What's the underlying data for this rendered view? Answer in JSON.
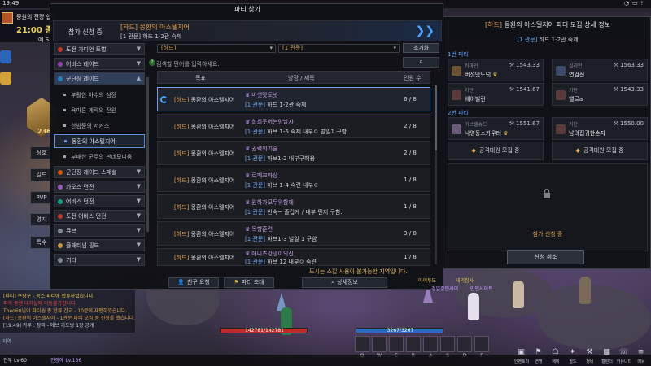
{
  "hud": {
    "clock": "19:49",
    "quest_title": "중원의 전장 합류",
    "quest_time": "21:00 종료",
    "quest_sub": "예 S",
    "side_menu": [
      "징호",
      "길드",
      "PVP",
      "명지",
      "특수"
    ],
    "emblem_number": "236",
    "top_icons": [
      "wifi-icon",
      "battery-icon",
      "signal-icon"
    ]
  },
  "window": {
    "title": "파티 찾기",
    "banner_label": "참가 신청 중",
    "banner_title": "[하드] 몽환의 아스텔지어",
    "banner_sub": "[1 관문] 하드 1-2관 숙제"
  },
  "categories": [
    {
      "label": "도전 가디언 토벌",
      "dot": "#c0392b",
      "expanded": false
    },
    {
      "label": "어비스 레이드",
      "dot": "#8e44ad",
      "expanded": false
    },
    {
      "label": "군단장 레이드",
      "dot": "#2980b9",
      "expanded": true
    }
  ],
  "sub_items": [
    "부활한 아수의 심장",
    "욕마른 계략의 잔원",
    "한밤중의 서커스",
    "몽환의 아스텔지어",
    "부패한 군주의 판데모니움"
  ],
  "categories_below": [
    {
      "label": "군단장 레이드 스페셜",
      "dot": "#d35400"
    },
    {
      "label": "카오스 던전",
      "dot": "#9b59b6"
    },
    {
      "label": "어비스 던전",
      "dot": "#16a085"
    },
    {
      "label": "도전 어비스 던전",
      "dot": "#c0392b"
    },
    {
      "label": "큐브",
      "dot": "#7f8c8d"
    },
    {
      "label": "플래티넘 필드",
      "dot": "#c39b3a"
    },
    {
      "label": "기타",
      "dot": "#7f8c8d"
    }
  ],
  "filters": {
    "difficulty": "[하드]",
    "stage": "[1 관문]",
    "reset": "초기화",
    "hint": "검색할 단어를 입력하세요.",
    "search_icon": "magnifier-icon"
  },
  "table": {
    "headers": [
      "목표",
      "방장 / 제목",
      "인원 수"
    ],
    "rows": [
      {
        "tag": "[하드]",
        "dungeon": "몽환의 아스텔지어",
        "leader": "버섯맛도넛",
        "stage": "[1 관문]",
        "desc": "하드 1-2관 숙제",
        "count": "6 / 8",
        "selected": true
      },
      {
        "tag": "[하드]",
        "dungeon": "몽환의 아스텔지어",
        "leader": "희희웃어는양날자",
        "stage": "[1 관문]",
        "desc": "하브 1-6 숙제 내부ㅇ 벌일1 구함",
        "count": "2 / 8",
        "selected": false
      },
      {
        "tag": "[하드]",
        "dungeon": "몽환의 아스텔지어",
        "leader": "권력의기술",
        "stage": "[1 관문]",
        "desc": "하브1-2 내부구해용",
        "count": "2 / 8",
        "selected": false
      },
      {
        "tag": "[하드]",
        "dungeon": "몽환의 아스텔지어",
        "leader": "로페크마상",
        "stage": "[1 관문]",
        "desc": "하브 1-4 숙련 내부ㅇ",
        "count": "1 / 8",
        "selected": false
      },
      {
        "tag": "[하드]",
        "dungeon": "몽환의 아스텔지어",
        "leader": "원하가모두위함께",
        "stage": "[1 관문]",
        "desc": "번숙~ 즐겁게 / 내부 먼저 구함.",
        "count": "1 / 8",
        "selected": false
      },
      {
        "tag": "[하드]",
        "dungeon": "몽환의 아스텔지어",
        "leader": "목향훈련",
        "stage": "[1 관문]",
        "desc": "하브1-3   벌일 1 구함",
        "count": "3 / 8",
        "selected": false
      },
      {
        "tag": "[하드]",
        "dungeon": "몽환의 아스텔지어",
        "leader": "애니츠강냉이의신",
        "stage": "[1 관문]",
        "desc": "하브 12 내부ㅇ 숙련",
        "count": "1 / 8",
        "selected": false
      }
    ]
  },
  "footer": {
    "notice": "도시는 스킬 사용이 불가능한 지역입니다.",
    "friend_invite": "친구 요청",
    "party_invite": "파티 초대",
    "detail": "상세정보"
  },
  "detail": {
    "title_tag": "[하드]",
    "title_name": "몽환의 아스텔지어",
    "title_rest": "파티 모집 상세 정보",
    "sub_stage": "[1 관문]",
    "sub_desc": "하드 1-2관 숙제",
    "party1_label": "1번 파티",
    "party2_label": "2번 파티",
    "members": [
      {
        "cls": "카마인",
        "name": "버섯맛도넛",
        "gs": "1543.33",
        "leader": true
      },
      {
        "cls": "실리안",
        "name": "연검전",
        "gs": "1563.33",
        "leader": false
      },
      {
        "cls": "카단",
        "name": "웨이빌런",
        "gs": "1541.67",
        "leader": false
      },
      {
        "cls": "카단",
        "name": "앨르a",
        "gs": "1543.33",
        "leader": false
      },
      {
        "cls": "아브렐슈드",
        "name": "낙영동스카우터",
        "gs": "1551.67",
        "leader": true
      },
      {
        "cls": "카단",
        "name": "남의집귀한손자",
        "gs": "1550.00",
        "leader": false
      }
    ],
    "recruit1": "공격대원 모집 중",
    "recruit2": "공격대원 모집 중",
    "status": "참가 신청 중",
    "cancel": "신청 취소"
  },
  "chat": {
    "lines": [
      {
        "text": "[파티] 쿠팡구 - 몽스 파티에 합류하였습니다.",
        "color": "#e0c25a"
      },
      {
        "text": "피격 중엔 대기실에 이동불가합니다.",
        "color": "#e04a4a"
      },
      {
        "text": "Theo60님이 파티원 총 합류 간교 - 10분에 재편하였습니다.",
        "color": "#d9a24d"
      },
      {
        "text": "[하드] 몽환의 아스텔지어 - 1관문 파티 모집 중 신청을 했습니다.",
        "color": "#d9a24d"
      },
      {
        "text": "[19:49] 카루 : 장미 - 에브 가도방 1장 공개",
        "color": "#cfd3da"
      }
    ],
    "input": "지역"
  },
  "status_bars": {
    "hp": "142781/142781",
    "hp_ratio": 1.0,
    "mp": "3267/3267",
    "mp_ratio": 1.0
  },
  "skill_keys": [
    "Q",
    "W",
    "E",
    "R",
    "A",
    "S",
    "D",
    "F"
  ],
  "characters": {
    "left": "전투 Lv.60",
    "right": "전장에 Lv.136"
  },
  "sys_labels": [
    "인벤토리",
    "연맹",
    "애비",
    "필드",
    "정비",
    "캘린더",
    "커뮤니티",
    "메뉴"
  ],
  "world_names": [
    {
      "text": "아이투도",
      "color": "#e0c25a"
    },
    {
      "text": "대리집사",
      "color": "#e0c25a"
    },
    {
      "text": "경일중인사이",
      "color": "#c8a0ff"
    },
    {
      "text": "만인사이트",
      "color": "#c8a0ff"
    }
  ]
}
